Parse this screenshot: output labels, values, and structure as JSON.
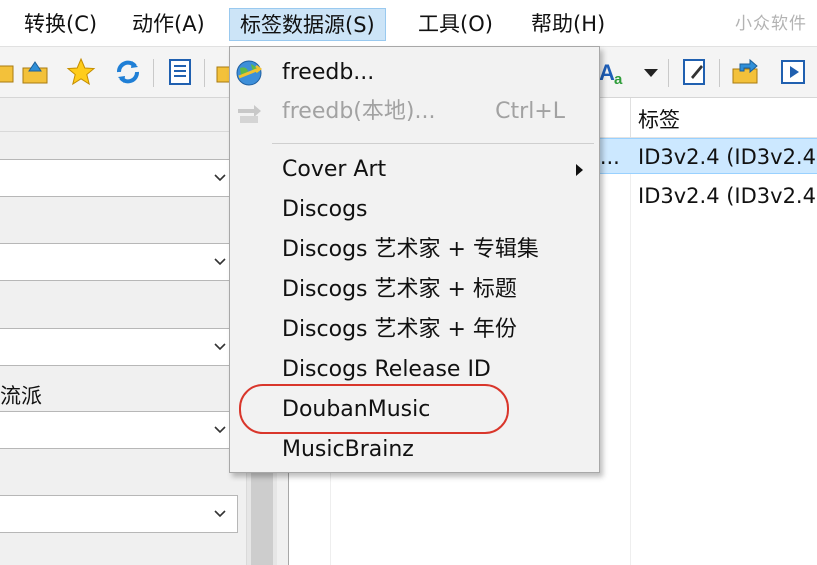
{
  "menubar": {
    "items": [
      "转换(C)",
      "动作(A)",
      "标签数据源(S)",
      "工具(O)",
      "帮助(H)"
    ],
    "active_index": 2
  },
  "watermark": "小众软件",
  "toolbar": {
    "icons": [
      "folder-open-icon",
      "folder-up-icon",
      "favorite-star-icon",
      "refresh-icon",
      "document-list-icon",
      "folder-icon",
      "text-case-icon",
      "dropdown-arrow-icon",
      "edit-note-icon",
      "export-folder-icon",
      "playlist-icon"
    ]
  },
  "left_panel": {
    "field_label": "流派"
  },
  "file_list": {
    "column_header": "标签",
    "rows": [
      {
        "fragment": "i...",
        "tag": "ID3v2.4 (ID3v2.4",
        "selected": true
      },
      {
        "fragment": "",
        "tag": "ID3v2.4 (ID3v2.4",
        "selected": false
      }
    ]
  },
  "dropdown": {
    "items": [
      {
        "label": "freedb...",
        "shortcut": "",
        "icon": "globe-icon",
        "disabled": false,
        "submenu": false
      },
      {
        "label": "freedb(本地)...",
        "shortcut": "Ctrl+L",
        "icon": "local-db-icon",
        "disabled": true,
        "submenu": false
      },
      {
        "label": "Cover Art",
        "shortcut": "",
        "icon": "",
        "disabled": false,
        "submenu": true
      },
      {
        "label": "Discogs",
        "shortcut": "",
        "icon": "",
        "disabled": false,
        "submenu": false
      },
      {
        "label": "Discogs 艺术家 + 专辑集",
        "shortcut": "",
        "icon": "",
        "disabled": false,
        "submenu": false
      },
      {
        "label": "Discogs 艺术家 + 标题",
        "shortcut": "",
        "icon": "",
        "disabled": false,
        "submenu": false
      },
      {
        "label": "Discogs 艺术家 + 年份",
        "shortcut": "",
        "icon": "",
        "disabled": false,
        "submenu": false
      },
      {
        "label": "Discogs Release ID",
        "shortcut": "",
        "icon": "",
        "disabled": false,
        "submenu": false
      },
      {
        "label": "DoubanMusic",
        "shortcut": "",
        "icon": "",
        "disabled": false,
        "submenu": false,
        "highlighted": true
      },
      {
        "label": "MusicBrainz",
        "shortcut": "",
        "icon": "",
        "disabled": false,
        "submenu": false
      }
    ]
  },
  "colors": {
    "menu_active_bg": "#cce4f7",
    "selection_bg": "#cce8ff",
    "highlight_ring": "#d9362b",
    "disabled_text": "#a2a2a2"
  }
}
